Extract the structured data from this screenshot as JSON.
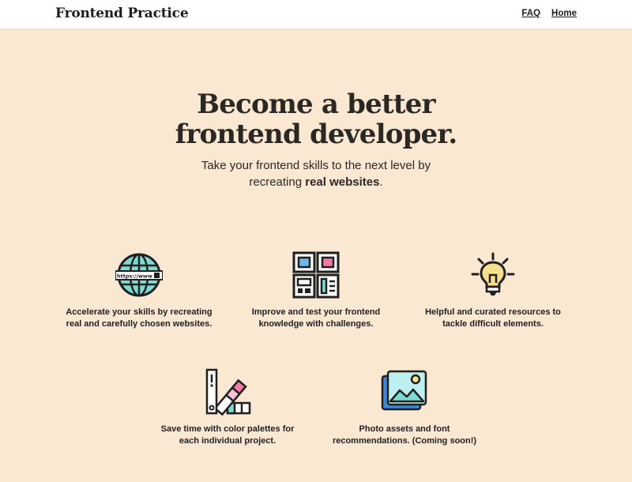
{
  "header": {
    "logo": "Frontend Practice",
    "nav": {
      "faq": "FAQ",
      "home": "Home"
    }
  },
  "hero": {
    "title_line1": "Become a better",
    "title_line2": "frontend developer.",
    "subtitle_line1": "Take your frontend skills to the next level by",
    "subtitle_line2_prefix": "recreating ",
    "subtitle_line2_bold": "real websites",
    "subtitle_line2_suffix": "."
  },
  "features": [
    {
      "icon": "globe-icon",
      "icon_text": "https://www",
      "line1": "Accelerate your skills by recreating",
      "line2": "real and carefully chosen websites."
    },
    {
      "icon": "layout-grid-icon",
      "line1": "Improve and test your frontend",
      "line2": "knowledge with challenges."
    },
    {
      "icon": "lightbulb-icon",
      "line1": "Helpful and curated resources to",
      "line2": "tackle difficult elements."
    },
    {
      "icon": "color-palette-icon",
      "line1": "Save time with color palettes for",
      "line2": "each individual project."
    },
    {
      "icon": "photo-icon",
      "line1": "Photo assets and font",
      "line2": "recommendations. (Coming soon!)"
    }
  ],
  "colors": {
    "background": "#fbe8d3",
    "header_bg": "#ffffff",
    "text": "#1f1f1f",
    "accent_teal": "#7ddcd0",
    "accent_pink": "#f27aa8",
    "accent_yellow": "#f8df8e",
    "accent_blue": "#6fb8e8"
  }
}
